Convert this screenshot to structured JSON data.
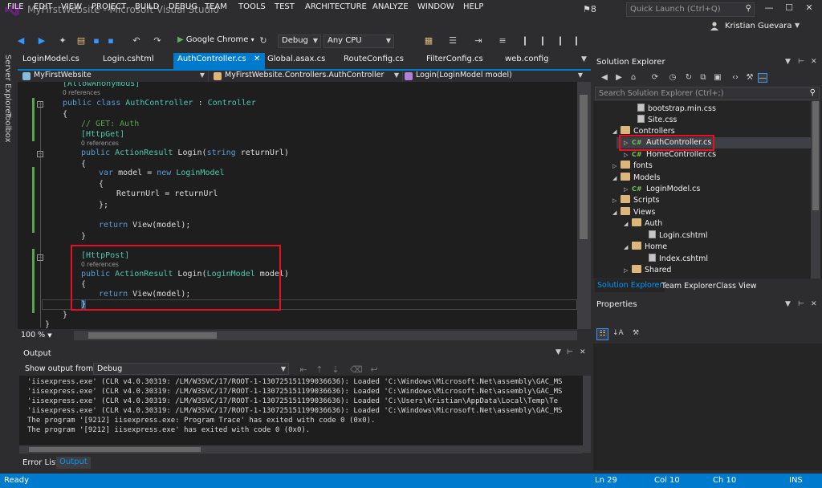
{
  "window": {
    "title": "MyFirstWebsite - Microsoft Visual Studio",
    "notifications": "8",
    "quick_launch_placeholder": "Quick Launch (Ctrl+Q)",
    "user": "Kristian Guevara"
  },
  "menu": [
    "FILE",
    "EDIT",
    "VIEW",
    "PROJECT",
    "BUILD",
    "DEBUG",
    "TEAM",
    "TOOLS",
    "TEST",
    "ARCHITECTURE",
    "ANALYZE",
    "WINDOW",
    "HELP"
  ],
  "toolbar": {
    "run_target": "Google Chrome",
    "configuration": "Debug",
    "platform": "Any CPU"
  },
  "left_rail": [
    "Server Explorer",
    "Toolbox"
  ],
  "doc_tabs": [
    "LoginModel.cs",
    "Login.cshtml",
    "AuthController.cs",
    "Global.asax.cs",
    "RouteConfig.cs",
    "FilterConfig.cs",
    "web.config"
  ],
  "navbar": {
    "project": "MyFirstWebsite",
    "class": "MyFirstWebsite.Controllers.AuthController",
    "member": "Login(LoginModel model)"
  },
  "code": {
    "attr_anon": "[AllowAnonymous]",
    "ref0": "0 references",
    "class_kw": "public class ",
    "class_name": "AuthController",
    "class_colon": " : ",
    "class_base": "Controller",
    "brace_open": "{",
    "brace_close": "}",
    "comment": "// GET: Auth",
    "attr_get": "[HttpGet]",
    "ref1": "0 references",
    "m1_kw": "public ",
    "m1_type": "ActionResult",
    "m1_rest": " Login(",
    "m1_kw2": "string",
    "m1_end": " returnUrl)",
    "var_kw": "var",
    "var_mid": " model = ",
    "new_kw": "new",
    "var_type": " LoginModel",
    "assign": "ReturnUrl = returnUrl",
    "close_semi": "};",
    "return1_kw": "return",
    "return1_rest": " View(model);",
    "attr_post": "[HttpPost]",
    "ref2": "0 references",
    "m2_kw": "public ",
    "m2_type": "ActionResult",
    "m2_rest": " Login(",
    "m2_ptype": "LoginModel",
    "m2_end": " model)",
    "return2_kw": "return",
    "return2_rest": " View(model);"
  },
  "zoom": "100 %",
  "output": {
    "title": "Output",
    "show_from_label": "Show output from:",
    "source": "Debug",
    "lines": [
      "'iisexpress.exe' (CLR v4.0.30319: /LM/W3SVC/17/ROOT-1-130725151199036636): Loaded 'C:\\Windows\\Microsoft.Net\\assembly\\GAC_MS",
      "'iisexpress.exe' (CLR v4.0.30319: /LM/W3SVC/17/ROOT-1-130725151199036636): Loaded 'C:\\Windows\\Microsoft.Net\\assembly\\GAC_MS",
      "'iisexpress.exe' (CLR v4.0.30319: /LM/W3SVC/17/ROOT-1-130725151199036636): Loaded 'C:\\Users\\Kristian\\AppData\\Local\\Temp\\Te",
      "'iisexpress.exe' (CLR v4.0.30319: /LM/W3SVC/17/ROOT-1-130725151199036636): Loaded 'C:\\Windows\\Microsoft.Net\\assembly\\GAC_MS",
      "The program '[9212] iisexpress.exe: Program Trace' has exited with code 0 (0x0).",
      "The program '[9212] iisexpress.exe' has exited with code 0 (0x0)."
    ]
  },
  "bottom_tabs": [
    "Error List",
    "Output"
  ],
  "solution_explorer": {
    "title": "Solution Explorer",
    "search_placeholder": "Search Solution Explorer (Ctrl+;)",
    "tree": [
      {
        "label": "bootstrap.min.css",
        "kind": "file"
      },
      {
        "label": "Site.css",
        "kind": "file"
      },
      {
        "label": "Controllers",
        "kind": "folder"
      },
      {
        "label": "AuthController.cs",
        "kind": "cs"
      },
      {
        "label": "HomeController.cs",
        "kind": "cs"
      },
      {
        "label": "fonts",
        "kind": "folder"
      },
      {
        "label": "Models",
        "kind": "folder"
      },
      {
        "label": "LoginModel.cs",
        "kind": "cs"
      },
      {
        "label": "Scripts",
        "kind": "folder"
      },
      {
        "label": "Views",
        "kind": "folder"
      },
      {
        "label": "Auth",
        "kind": "folder"
      },
      {
        "label": "Login.cshtml",
        "kind": "file"
      },
      {
        "label": "Home",
        "kind": "folder"
      },
      {
        "label": "Index.cshtml",
        "kind": "file"
      },
      {
        "label": "Shared",
        "kind": "folder"
      }
    ],
    "tabs": [
      "Solution Explorer",
      "Team Explorer",
      "Class View"
    ]
  },
  "properties": {
    "title": "Properties"
  },
  "status": {
    "ready": "Ready",
    "ln": "Ln 29",
    "col": "Col 10",
    "ch": "Ch 10",
    "ins": "INS"
  },
  "colors": {
    "accent": "#007acc",
    "highlight": "#e81123"
  }
}
